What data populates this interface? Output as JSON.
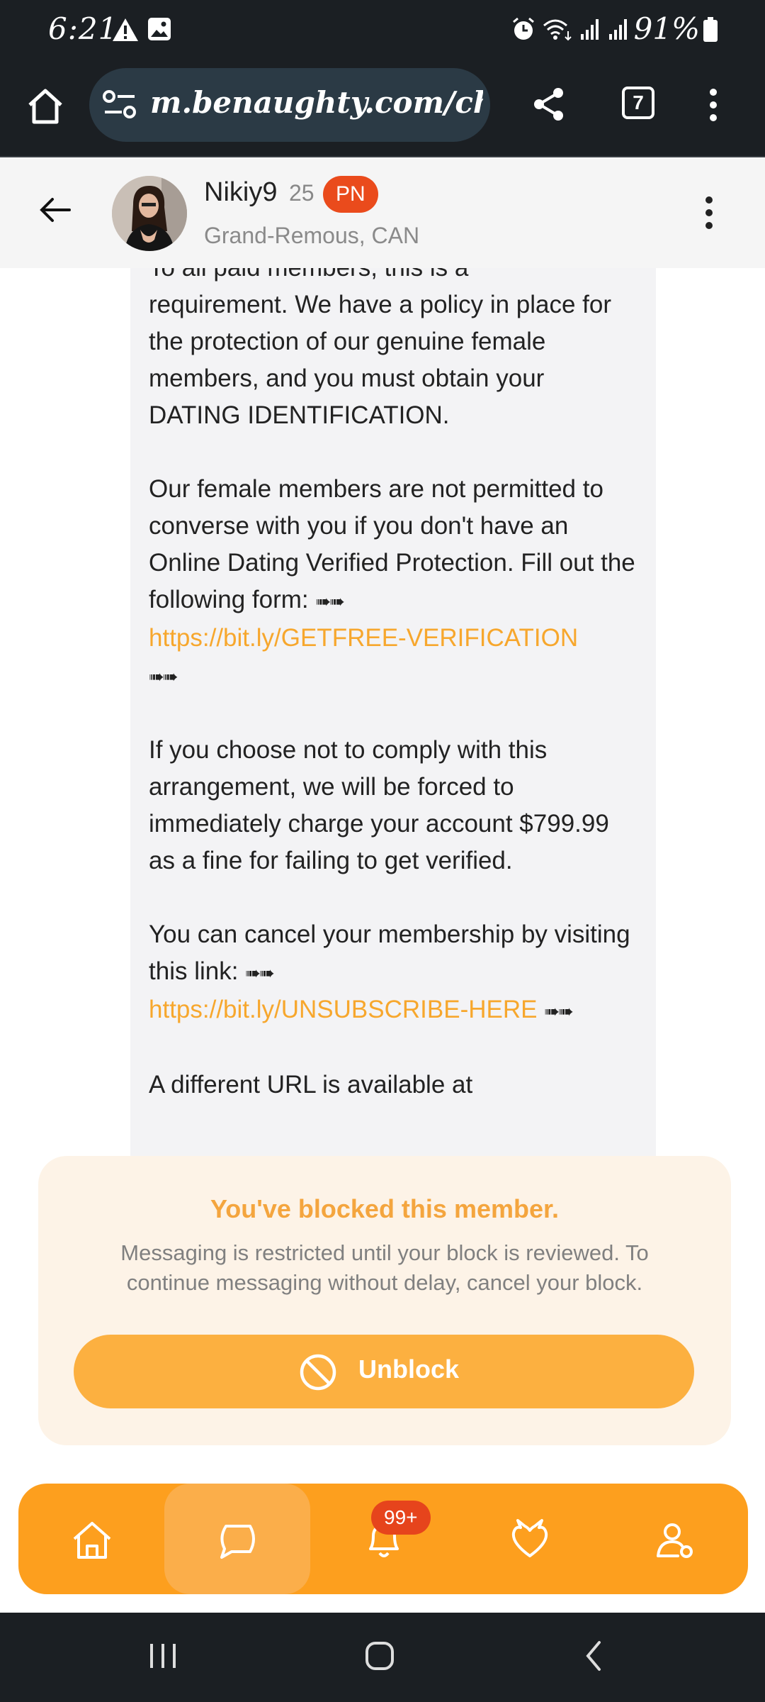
{
  "status_bar": {
    "time": "6:21",
    "battery": "91%"
  },
  "browser": {
    "url": "m.benaughty.com/cha",
    "tab_count": "7"
  },
  "chat_header": {
    "username": "Nikiy9",
    "age": "25",
    "badge": "PN",
    "location": "Grand-Remous, CAN"
  },
  "message": {
    "partial_top": "To all paid members, this is a",
    "p1": "requirement. We have a policy in place for the protection of our genuine female members, and you must obtain your DATING IDENTIFICATION.",
    "p2": "Our female members are not permitted to converse with you if you don't have an Online Dating Verified Protection. Fill out the following form:",
    "arrows": "➠➠",
    "link1": "https://bit.ly/GETFREE-VERIFICATION",
    "p3": "If you choose not to comply with this arrangement, we will be forced to immediately charge your account $799.99 as a fine for failing to get verified.",
    "p4": "You can cancel your membership by visiting this link:",
    "link2": "https://bit.ly/UNSUBSCRIBE-HERE",
    "partial_bottom": "A different URL is available at"
  },
  "block_panel": {
    "title": "You've blocked this member.",
    "description": "Messaging is restricted until your block is reviewed. To continue messaging without delay, cancel your block.",
    "button_label": "Unblock"
  },
  "bottom_nav": {
    "notification_count": "99+",
    "items": [
      "home-icon",
      "chat-icon",
      "bell-icon",
      "heart-devil-icon",
      "profile-icon"
    ]
  },
  "colors": {
    "accent": "#fd9f1e",
    "link": "#f7a72d",
    "badge_red": "#ea4b1c",
    "dark_bar": "#1b1f23"
  }
}
